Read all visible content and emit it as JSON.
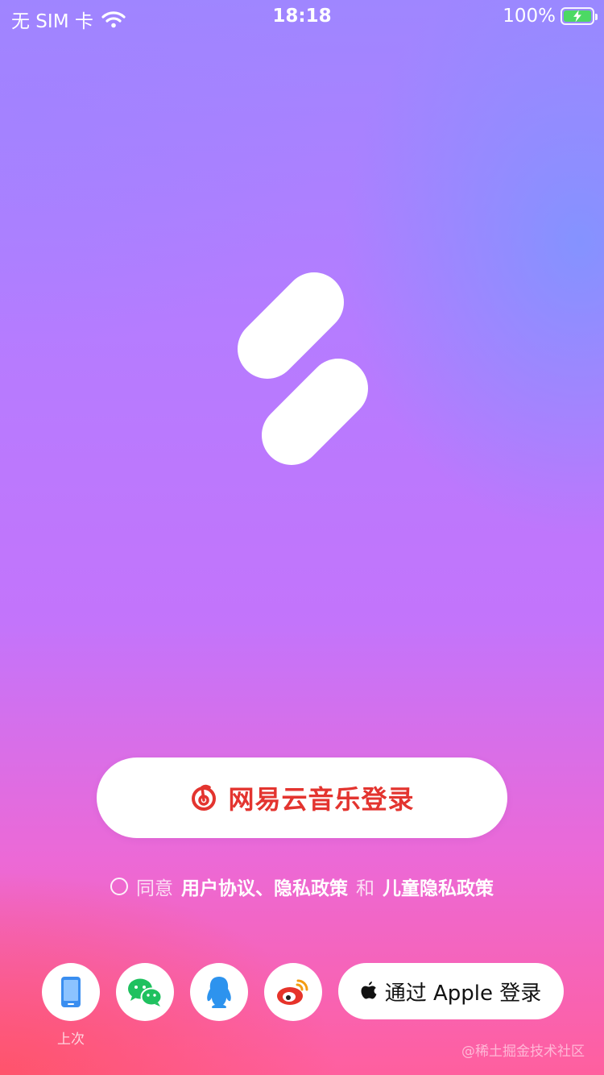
{
  "status_bar": {
    "carrier": "无 SIM 卡",
    "time": "18:18",
    "battery_percent": "100%",
    "battery_level": 1.0,
    "battery_color": "#4cd964"
  },
  "logo": {
    "icon": "app-logo-icon",
    "color": "#ffffff"
  },
  "main_login": {
    "label": "网易云音乐登录",
    "icon": "netease-music-icon",
    "color": "#e3342f"
  },
  "agreement": {
    "prefix": "同意",
    "user_agreement": "用户协议",
    "separator": "、",
    "privacy_policy": "隐私政策",
    "conjunction": "和",
    "children_privacy": "儿童隐私政策",
    "checked": false
  },
  "login_methods": {
    "phone": {
      "icon": "phone-icon",
      "caption": "上次",
      "color": "#3a8ef0"
    },
    "wechat": {
      "icon": "wechat-icon",
      "color": "#1fc15f"
    },
    "qq": {
      "icon": "qq-icon",
      "color": "#2d93ee"
    },
    "weibo": {
      "icon": "weibo-icon",
      "color": "#e6332a"
    },
    "apple": {
      "icon": "apple-icon",
      "label": "通过 Apple 登录"
    }
  },
  "watermark": "@稀土掘金技术社区"
}
